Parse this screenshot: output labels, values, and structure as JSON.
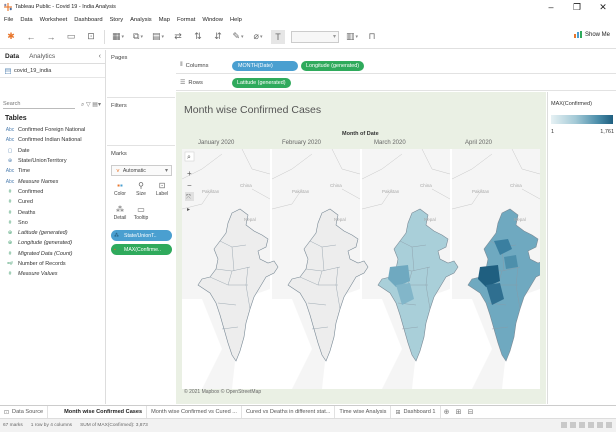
{
  "window": {
    "title": "Tableau Public - Covid 19 - India Analysis",
    "minimize": "–",
    "maximize": "❐",
    "close": "✕"
  },
  "menu": [
    "File",
    "Data",
    "Worksheet",
    "Dashboard",
    "Story",
    "Analysis",
    "Map",
    "Format",
    "Window",
    "Help"
  ],
  "toolbar": {
    "show_me": "Show Me"
  },
  "data_pane": {
    "tabs": [
      "Data",
      "Analytics"
    ],
    "collapse": "‹",
    "data_source": "covid_19_india",
    "search_placeholder": "Search",
    "tables_header": "Tables",
    "fields": [
      {
        "type": "Abc",
        "label": "Confirmed Foreign National",
        "kind": "dim"
      },
      {
        "type": "Abc",
        "label": "Confirmed Indian National",
        "kind": "dim"
      },
      {
        "type": "▢",
        "label": "Date",
        "kind": "dim"
      },
      {
        "type": "⊕",
        "label": "State/UnionTerritory",
        "kind": "dim"
      },
      {
        "type": "Abc",
        "label": "Time",
        "kind": "dim"
      },
      {
        "type": "Abc",
        "label": "Measure Names",
        "kind": "dim",
        "italic": true
      },
      {
        "type": "#",
        "label": "Confirmed",
        "kind": "meas"
      },
      {
        "type": "#",
        "label": "Cured",
        "kind": "meas"
      },
      {
        "type": "#",
        "label": "Deaths",
        "kind": "meas"
      },
      {
        "type": "#",
        "label": "Sno",
        "kind": "meas"
      },
      {
        "type": "⊕",
        "label": "Latitude (generated)",
        "kind": "meas",
        "italic": true
      },
      {
        "type": "⊕",
        "label": "Longitude (generated)",
        "kind": "meas",
        "italic": true
      },
      {
        "type": "#",
        "label": "Migrated Data (Count)",
        "kind": "meas",
        "italic": true
      },
      {
        "type": "=#",
        "label": "Number of Records",
        "kind": "meas"
      },
      {
        "type": "#",
        "label": "Measure Values",
        "kind": "meas",
        "italic": true
      }
    ]
  },
  "cards": {
    "pages": "Pages",
    "filters": "Filters",
    "marks": "Marks",
    "mark_type": "Automatic",
    "mark_buttons": [
      "Color",
      "Size",
      "Label",
      "Detail",
      "Tooltip"
    ],
    "mark_pills": [
      "State/UnionT..",
      "MAX(Confirme.."
    ]
  },
  "shelves": {
    "columns_label": "Columns",
    "rows_label": "Rows",
    "column_pills": [
      "MONTH(Date)",
      "Longitude (generated)"
    ],
    "row_pills": [
      "Latitude (generated)"
    ]
  },
  "viz": {
    "title": "Month wise Confirmed Cases",
    "column_header": "Month of Date",
    "months": [
      "January 2020",
      "February 2020",
      "March 2020",
      "April 2020"
    ],
    "copyright": "© 2021 Mapbox © OpenStreetMap",
    "map_controls": [
      "⌕",
      "+",
      "−",
      "⤧",
      "▸"
    ]
  },
  "legend": {
    "title": "MAX(Confirmed)",
    "min": "1",
    "max": "1,761",
    "colors": {
      "low": "#e6f1f4",
      "mid": "#4d8fab",
      "high": "#1f5f80"
    }
  },
  "sheet_tabs": {
    "data_source": "Data Source",
    "sheets": [
      "Month wise Confirmed Cases",
      "Month wise Confirmed vs Cured ...",
      "Cured vs Deaths in different stat...",
      "Time wise Analysis",
      "Dashboard 1"
    ]
  },
  "status": {
    "marks": "67 marks",
    "dims": "1 row by 4 columns",
    "sum": "SUM of MAX(Confirmed): 3,873"
  }
}
